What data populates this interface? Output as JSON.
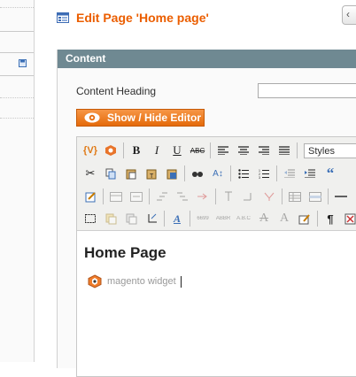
{
  "header": {
    "title": "Edit Page 'Home page'"
  },
  "section": {
    "title": "Content",
    "content_heading_label": "Content Heading",
    "content_heading_value": "",
    "show_hide_editor_label": "Show / Hide Editor"
  },
  "editor": {
    "toolbar": {
      "styles_select_value": "Styles",
      "quote_glyph": "“",
      "paragraph_glyph": "¶"
    },
    "content": {
      "heading": "Home Page",
      "widget_label": "magento widget"
    }
  },
  "colors": {
    "title_accent": "#eb5e00",
    "section_header_bg": "#6f8992",
    "button_orange": "#f08025"
  }
}
